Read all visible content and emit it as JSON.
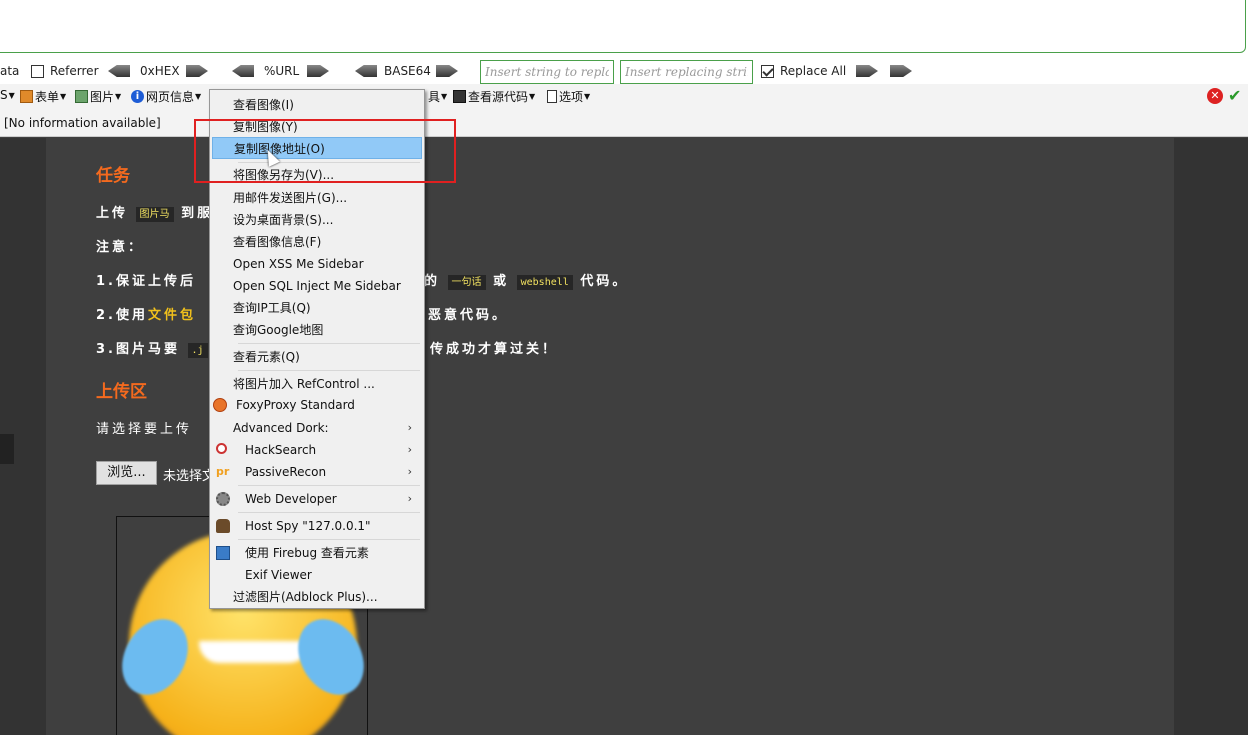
{
  "hackbar": {
    "data_label": "ata",
    "referrer_label": "Referrer",
    "hex_label": "0xHEX",
    "url_label": "%URL",
    "base64_label": "BASE64",
    "replace_from_placeholder": "Insert string to replace",
    "replace_to_placeholder": "Insert replacing string",
    "replace_all_label": "Replace All"
  },
  "toolbar": {
    "first_label": "S",
    "form_label": "表单",
    "image_label": "图片",
    "info_label": "网页信息",
    "tools_label": "具",
    "source_label": "查看源代码",
    "options_label": "选项"
  },
  "status": {
    "text": "[No information available]"
  },
  "content": {
    "task_title": "任务",
    "task_line_pre": "上传",
    "task_code": "图片马",
    "task_line_post": "到服",
    "note": "注意：",
    "item1_pre": "1.保证上传后",
    "item1_mid": "的",
    "item1_code1": "一句话",
    "item1_or": "或",
    "item1_code2": "webshell",
    "item1_post": "代码。",
    "item2_pre": "2.使用",
    "item2_yellow": "文件包",
    "item2_post": "恶意代码。",
    "item3_pre": "3.图片马要",
    "item3_code": ".j",
    "item3_post": "传成功才算过关！",
    "upload_title": "上传区",
    "upload_prompt": "请选择要上传",
    "browse_button": "浏览...",
    "file_status": "未选择文"
  },
  "context_menu": {
    "items": [
      {
        "label": "查看图像(I)"
      },
      {
        "label": "复制图像(Y)"
      },
      {
        "label": "复制图像地址(O)",
        "highlighted": true
      },
      {
        "label": "将图像另存为(V)..."
      },
      {
        "label": "用邮件发送图片(G)..."
      },
      {
        "label": "设为桌面背景(S)..."
      },
      {
        "label": "查看图像信息(F)"
      },
      {
        "label": "Open XSS Me Sidebar"
      },
      {
        "label": "Open SQL Inject Me Sidebar"
      },
      {
        "label": "查询IP工具(Q)"
      },
      {
        "label": "查询Google地图"
      },
      {
        "label": "查看元素(Q)"
      },
      {
        "label": "将图片加入 RefControl ..."
      },
      {
        "label": "FoxyProxy Standard",
        "icon": "foxyproxy-icon"
      },
      {
        "label": "Advanced Dork:",
        "submenu": true
      },
      {
        "label": "HackSearch",
        "icon": "hacksearch-icon",
        "submenu": true
      },
      {
        "label": "PassiveRecon",
        "icon": "passiverecon-icon",
        "submenu": true
      },
      {
        "label": "Web Developer",
        "icon": "gear-icon",
        "submenu": true
      },
      {
        "label": "Host Spy \"127.0.0.1\"",
        "icon": "spy-icon"
      },
      {
        "label": "使用 Firebug 查看元素",
        "icon": "firebug-icon"
      },
      {
        "label": "Exif Viewer"
      },
      {
        "label": "过滤图片(Adblock Plus)..."
      }
    ],
    "submenu_arrow": "›",
    "pr_glyph": "pr"
  },
  "colors": {
    "accent_orange": "#f46a1e",
    "highlight_blue": "#91c9f7",
    "annotation_red": "#e02020"
  }
}
